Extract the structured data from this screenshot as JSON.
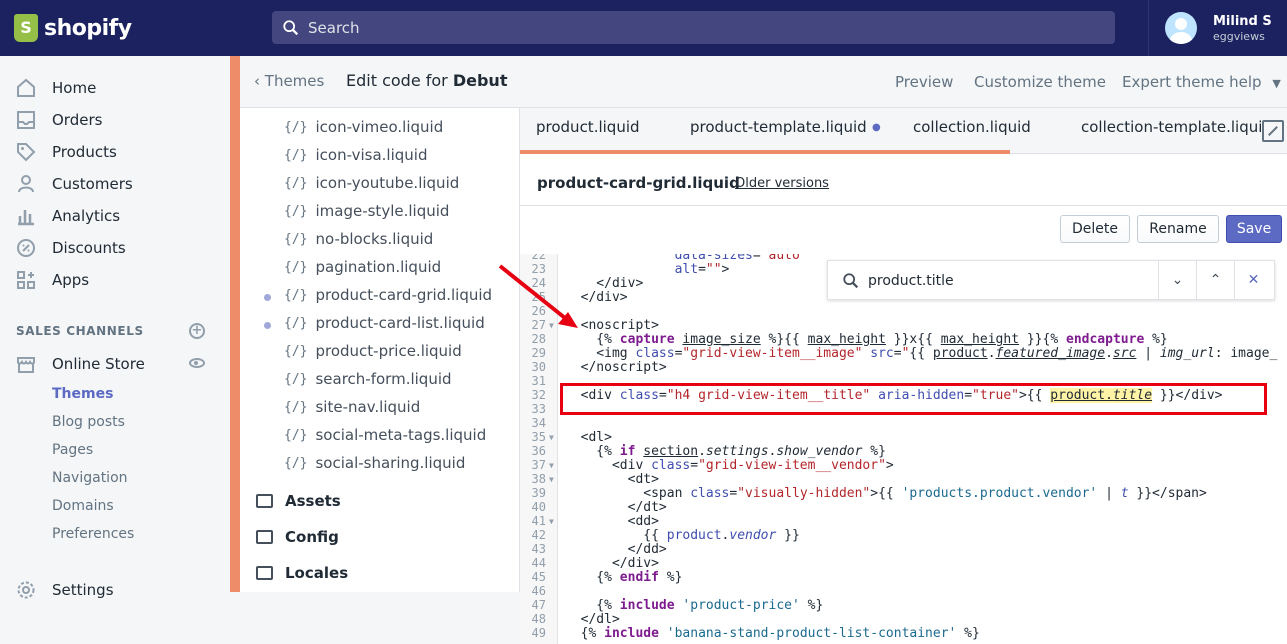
{
  "topbar": {
    "brand": "shopify",
    "search_placeholder": "Search",
    "user_name": "Milind S",
    "user_shop": "eggviews"
  },
  "sidebar": {
    "items": [
      {
        "label": "Home",
        "icon": "home-icon"
      },
      {
        "label": "Orders",
        "icon": "orders-icon"
      },
      {
        "label": "Products",
        "icon": "tag-icon"
      },
      {
        "label": "Customers",
        "icon": "person-icon"
      },
      {
        "label": "Analytics",
        "icon": "bar-chart-icon"
      },
      {
        "label": "Discounts",
        "icon": "discount-icon"
      },
      {
        "label": "Apps",
        "icon": "apps-icon"
      }
    ],
    "sales_channels_title": "SALES CHANNELS",
    "online_store": "Online Store",
    "sub_items": [
      "Themes",
      "Blog posts",
      "Pages",
      "Navigation",
      "Domains",
      "Preferences"
    ],
    "settings": "Settings"
  },
  "header": {
    "back_label": "Themes",
    "edit_prefix": "Edit code for",
    "theme_name": "Debut",
    "preview": "Preview",
    "customize": "Customize theme",
    "expert_help": "Expert theme help"
  },
  "filetree": {
    "files": [
      {
        "name": "icon-vimeo.liquid",
        "modified": false
      },
      {
        "name": "icon-visa.liquid",
        "modified": false
      },
      {
        "name": "icon-youtube.liquid",
        "modified": false
      },
      {
        "name": "image-style.liquid",
        "modified": false
      },
      {
        "name": "no-blocks.liquid",
        "modified": false
      },
      {
        "name": "pagination.liquid",
        "modified": false
      },
      {
        "name": "product-card-grid.liquid",
        "modified": true
      },
      {
        "name": "product-card-list.liquid",
        "modified": true
      },
      {
        "name": "product-price.liquid",
        "modified": false
      },
      {
        "name": "search-form.liquid",
        "modified": false
      },
      {
        "name": "site-nav.liquid",
        "modified": false
      },
      {
        "name": "social-meta-tags.liquid",
        "modified": false
      },
      {
        "name": "social-sharing.liquid",
        "modified": false
      }
    ],
    "folders": [
      "Assets",
      "Config",
      "Locales"
    ],
    "liquid_glyph": "{/}"
  },
  "editor": {
    "tabs": [
      "product.liquid",
      "product-template.liquid",
      "collection.liquid",
      "collection-template.liquid"
    ],
    "file_name": "product-card-grid.liquid",
    "older_versions": "Older versions",
    "buttons": {
      "delete": "Delete",
      "rename": "Rename",
      "save": "Save"
    },
    "find_query": "product.title",
    "line_numbers": [
      "22",
      "23",
      "24",
      "25",
      "26",
      "27",
      "28",
      "29",
      "30",
      "31",
      "32",
      "33",
      "34",
      "35",
      "36",
      "37",
      "38",
      "39",
      "40",
      "41",
      "42",
      "43",
      "44",
      "45",
      "46",
      "47",
      "48",
      "49"
    ]
  },
  "colors": {
    "topbar": "#1c2260",
    "accent": "#5c6ac4",
    "orange": "#ee8c6a",
    "annotation_red": "#e60012"
  }
}
